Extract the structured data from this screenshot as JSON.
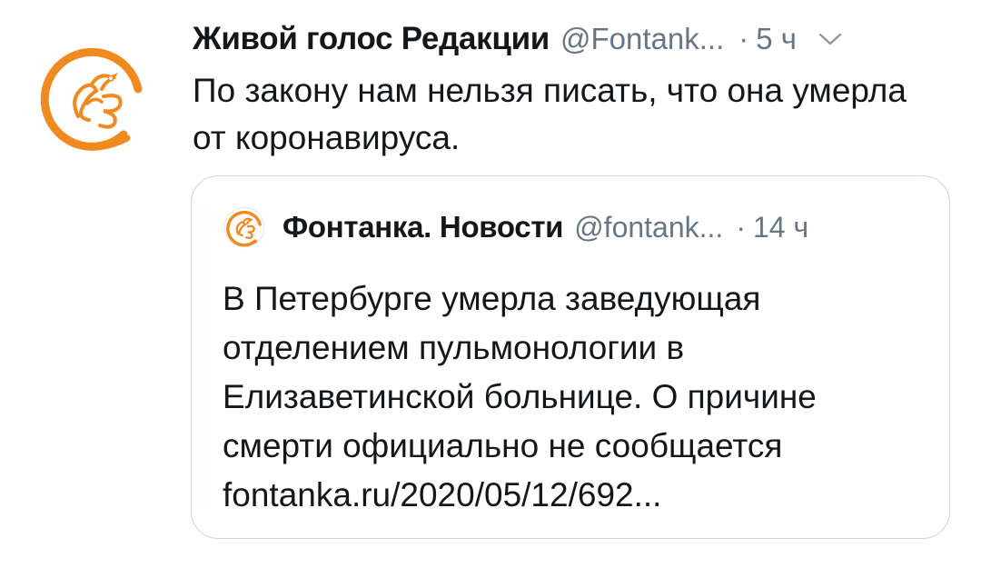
{
  "tweet": {
    "author": {
      "display_name": "Живой голос Редакции",
      "handle": "@Fontank...",
      "avatar_icon": "fontanka-bird-logo-icon"
    },
    "separator": "·",
    "timestamp": "5 ч",
    "menu_icon": "chevron-down-icon",
    "text": "По закону нам нельзя писать, что она умерла от коронавируса.",
    "quoted_tweet": {
      "author": {
        "display_name": "Фонтанка. Новости",
        "handle": "@fontank...",
        "avatar_icon": "fontanka-bird-logo-icon"
      },
      "separator": "·",
      "timestamp": "14 ч",
      "text_lines": [
        "В Петербурге умерла заведующая",
        "отделением пульмонологии в",
        "Елизаветинской больнице. О причине",
        "смерти официально не сообщается",
        "fontanka.ru/2020/05/12/692..."
      ]
    }
  },
  "colors": {
    "brand_orange": "#f0891e",
    "text_primary": "#14171a",
    "text_secondary": "#657786",
    "border": "#ccd6dd"
  }
}
